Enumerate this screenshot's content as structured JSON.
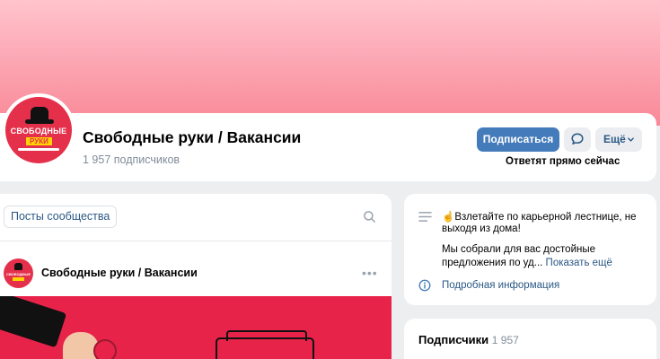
{
  "group": {
    "title": "Свободные руки / Вакансии",
    "subscribers_label": "1 957 подписчиков",
    "avatar_text_top": "СВОБОДНЫЕ",
    "avatar_text_bottom": "РУКИ"
  },
  "actions": {
    "subscribe_label": "Подписаться",
    "more_label": "Ещё",
    "reply_note": "Ответят прямо сейчас"
  },
  "icons": {
    "message": "message-icon",
    "chevron": "chevron-down-icon",
    "search": "search-icon",
    "description": "text-lines-icon",
    "info": "info-icon",
    "post_menu": "more-horizontal-icon"
  },
  "feed": {
    "posts_tab_label": "Посты сообщества",
    "post_author": "Свободные руки / Вакансии",
    "post_menu_glyph": "•••"
  },
  "about": {
    "line1": "☝Взлетайте по карьерной лестнице, не",
    "line2": "выходя из дома!",
    "line3": "Мы собрали для вас достойные",
    "line4_prefix": "предложения по уд... ",
    "show_more": "Показать ещё",
    "details_link": "Подробная информация"
  },
  "subscribers_block": {
    "title": "Подписчики",
    "count": "1 957"
  },
  "colors": {
    "primary_button": "#447bba",
    "link": "#2a5885",
    "cover_top": "#ffc4cd",
    "cover_bottom": "#f98897",
    "brand_red": "#e5304b"
  }
}
